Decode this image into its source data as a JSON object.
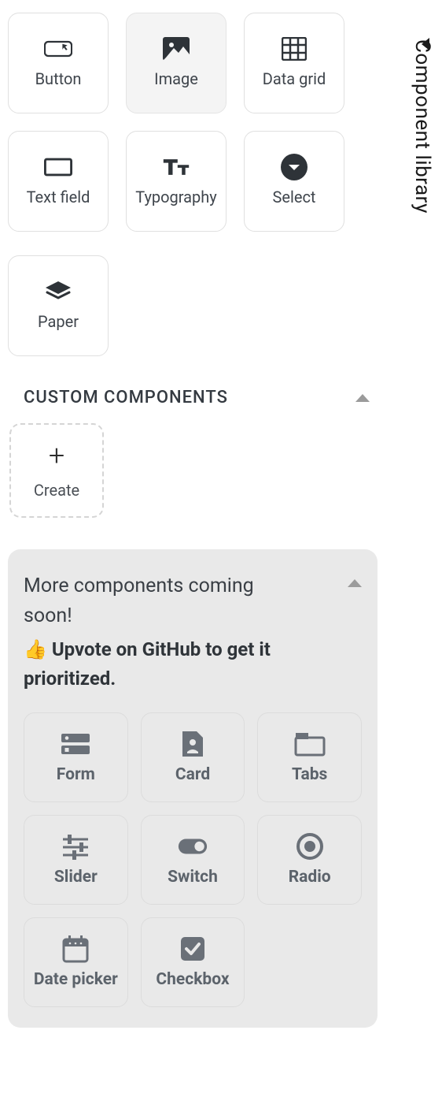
{
  "sidebar": {
    "title": "Component library"
  },
  "components": [
    {
      "label": "Button",
      "icon": "button-icon",
      "selected": false
    },
    {
      "label": "Image",
      "icon": "image-icon",
      "selected": true
    },
    {
      "label": "Data grid",
      "icon": "data-grid-icon",
      "selected": false
    },
    {
      "label": "Text field",
      "icon": "text-field-icon",
      "selected": false
    },
    {
      "label": "Typography",
      "icon": "typography-icon",
      "selected": false
    },
    {
      "label": "Select",
      "icon": "select-icon",
      "selected": false
    },
    {
      "label": "Paper",
      "icon": "paper-icon",
      "selected": false
    }
  ],
  "custom_section": {
    "heading": "CUSTOM COMPONENTS",
    "create_label": "Create"
  },
  "coming_soon": {
    "title": "More components coming soon!",
    "subtitle_emoji": "👍",
    "subtitle": "Upvote on GitHub to get it prioritized.",
    "items": [
      {
        "label": "Form",
        "icon": "form-icon"
      },
      {
        "label": "Card",
        "icon": "card-icon"
      },
      {
        "label": "Tabs",
        "icon": "tabs-icon"
      },
      {
        "label": "Slider",
        "icon": "slider-icon"
      },
      {
        "label": "Switch",
        "icon": "switch-icon"
      },
      {
        "label": "Radio",
        "icon": "radio-icon"
      },
      {
        "label": "Date picker",
        "icon": "date-picker-icon"
      },
      {
        "label": "Checkbox",
        "icon": "checkbox-icon"
      }
    ]
  }
}
